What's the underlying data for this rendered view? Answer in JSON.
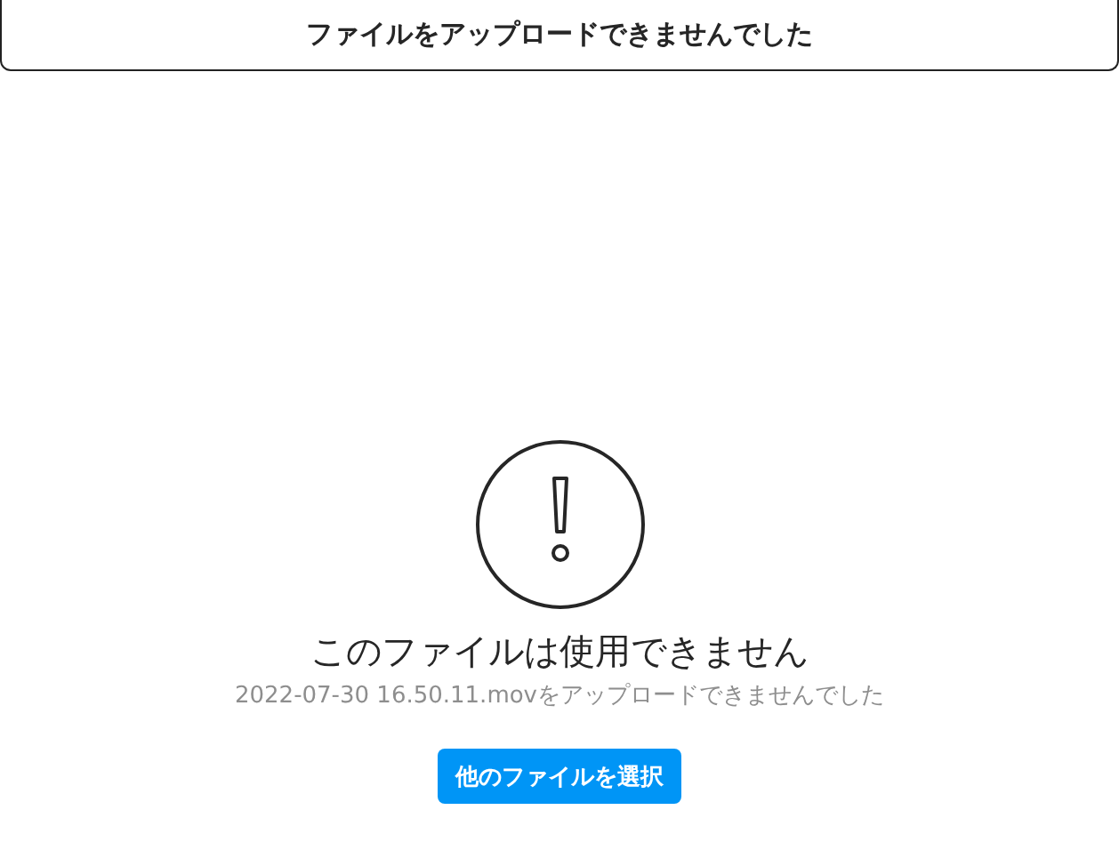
{
  "header": {
    "title": "ファイルをアップロードできませんでした"
  },
  "message": {
    "heading": "このファイルは使用できません",
    "detail": "2022-07-30 16.50.11.movをアップロードできませんでした"
  },
  "buttons": [
    {
      "label": "他のファイルを選択",
      "kind": "primary"
    }
  ]
}
